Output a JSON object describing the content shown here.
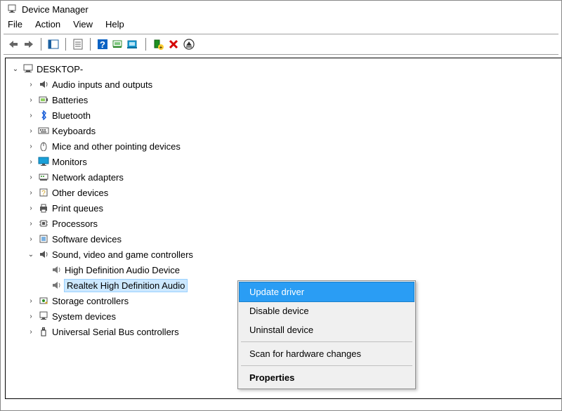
{
  "title": "Device Manager",
  "menu": {
    "file": "File",
    "action": "Action",
    "view": "View",
    "help": "Help"
  },
  "toolbar_icons": {
    "back": "back-arrow-icon",
    "forward": "forward-arrow-icon",
    "show_hide": "show-hide-tree-icon",
    "properties": "properties-sheet-icon",
    "help": "help-icon",
    "scan": "scan-hardware-icon",
    "update": "update-driver-icon",
    "add_device": "add-device-icon",
    "uninstall": "uninstall-icon",
    "eject": "eject-icon"
  },
  "root": {
    "label": "DESKTOP-"
  },
  "categories": [
    {
      "icon": "audio",
      "label": "Audio inputs and outputs"
    },
    {
      "icon": "battery",
      "label": "Batteries"
    },
    {
      "icon": "bluetooth",
      "label": "Bluetooth"
    },
    {
      "icon": "keyboard",
      "label": "Keyboards"
    },
    {
      "icon": "mouse",
      "label": "Mice and other pointing devices"
    },
    {
      "icon": "monitor",
      "label": "Monitors"
    },
    {
      "icon": "network",
      "label": "Network adapters"
    },
    {
      "icon": "other",
      "label": "Other devices"
    },
    {
      "icon": "print",
      "label": "Print queues"
    },
    {
      "icon": "cpu",
      "label": "Processors"
    },
    {
      "icon": "software",
      "label": "Software devices"
    }
  ],
  "sound_category": {
    "label": "Sound, video and game controllers",
    "children": [
      {
        "label": "High Definition Audio Device"
      },
      {
        "label": "Realtek High Definition Audio"
      }
    ]
  },
  "remaining_categories": [
    {
      "icon": "storage",
      "label": "Storage controllers"
    },
    {
      "icon": "system",
      "label": "System devices"
    },
    {
      "icon": "usb",
      "label": "Universal Serial Bus controllers"
    }
  ],
  "context_menu": {
    "update": "Update driver",
    "disable": "Disable device",
    "uninstall": "Uninstall device",
    "scan": "Scan for hardware changes",
    "properties": "Properties"
  }
}
